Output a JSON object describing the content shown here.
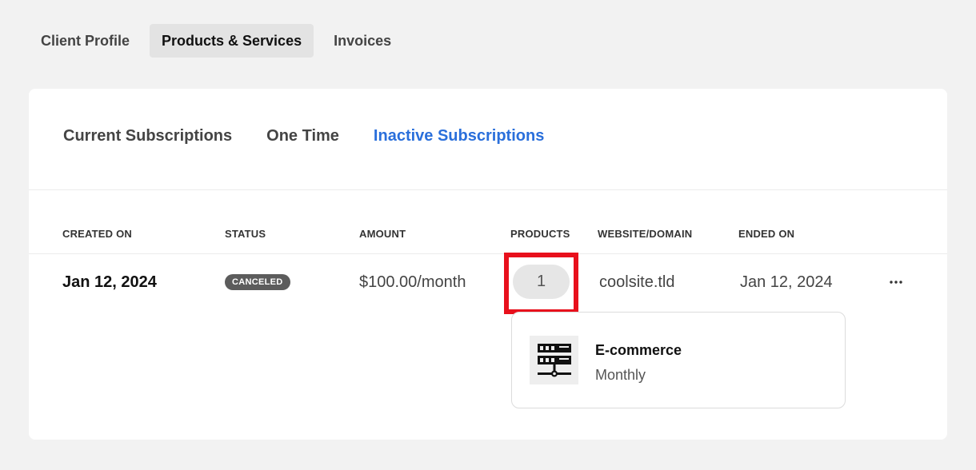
{
  "top_tabs": [
    {
      "label": "Client Profile",
      "active": false
    },
    {
      "label": "Products & Services",
      "active": true
    },
    {
      "label": "Invoices",
      "active": false
    }
  ],
  "sub_tabs": [
    {
      "label": "Current Subscriptions",
      "active": false
    },
    {
      "label": "One Time",
      "active": false
    },
    {
      "label": "Inactive Subscriptions",
      "active": true
    }
  ],
  "table": {
    "headers": [
      "CREATED ON",
      "STATUS",
      "AMOUNT",
      "PRODUCTS",
      "WEBSITE/DOMAIN",
      "ENDED ON"
    ],
    "rows": [
      {
        "created_on": "Jan 12, 2024",
        "status": "CANCELED",
        "amount": "$100.00/month",
        "products": "1",
        "domain": "coolsite.tld",
        "ended_on": "Jan 12, 2024",
        "more_icon": "ellipsis-icon"
      }
    ]
  },
  "product_popup": {
    "icon": "server-icon",
    "name": "E-commerce",
    "billing": "Monthly"
  },
  "colors": {
    "accent": "#2a6fdb",
    "highlight": "#e8101c",
    "badge_bg": "#5c5c5c"
  }
}
